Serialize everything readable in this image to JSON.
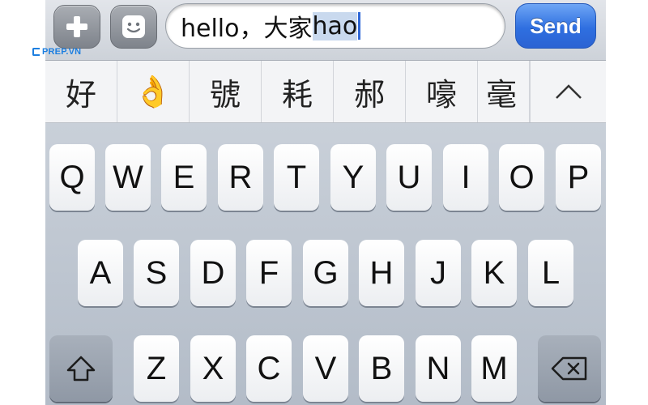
{
  "watermark": {
    "brand": "PREP.VN"
  },
  "topbar": {
    "field_text_committed": "hello，大家",
    "field_text_marked": "hao",
    "send_label": "Send",
    "add_icon": "plus-icon",
    "emoji_icon": "smiley-icon"
  },
  "candidates": {
    "items": [
      "好",
      "👌",
      "號",
      "耗",
      "郝",
      "嚎",
      "毫"
    ],
    "expand_icon": "chevron-up-icon"
  },
  "keyboard": {
    "row1": [
      "Q",
      "W",
      "E",
      "R",
      "T",
      "Y",
      "U",
      "I",
      "O",
      "P"
    ],
    "row2": [
      "A",
      "S",
      "D",
      "F",
      "G",
      "H",
      "J",
      "K",
      "L"
    ],
    "row3": [
      "Z",
      "X",
      "C",
      "V",
      "B",
      "N",
      "M"
    ],
    "shift_icon": "shift-icon",
    "delete_icon": "backspace-icon"
  },
  "colors": {
    "send_blue": "#2f6fe0",
    "keyboard_bg": "#c0c8d2",
    "marked_text_bg": "#c9d9ee",
    "brand_blue": "#1d7fe0"
  }
}
